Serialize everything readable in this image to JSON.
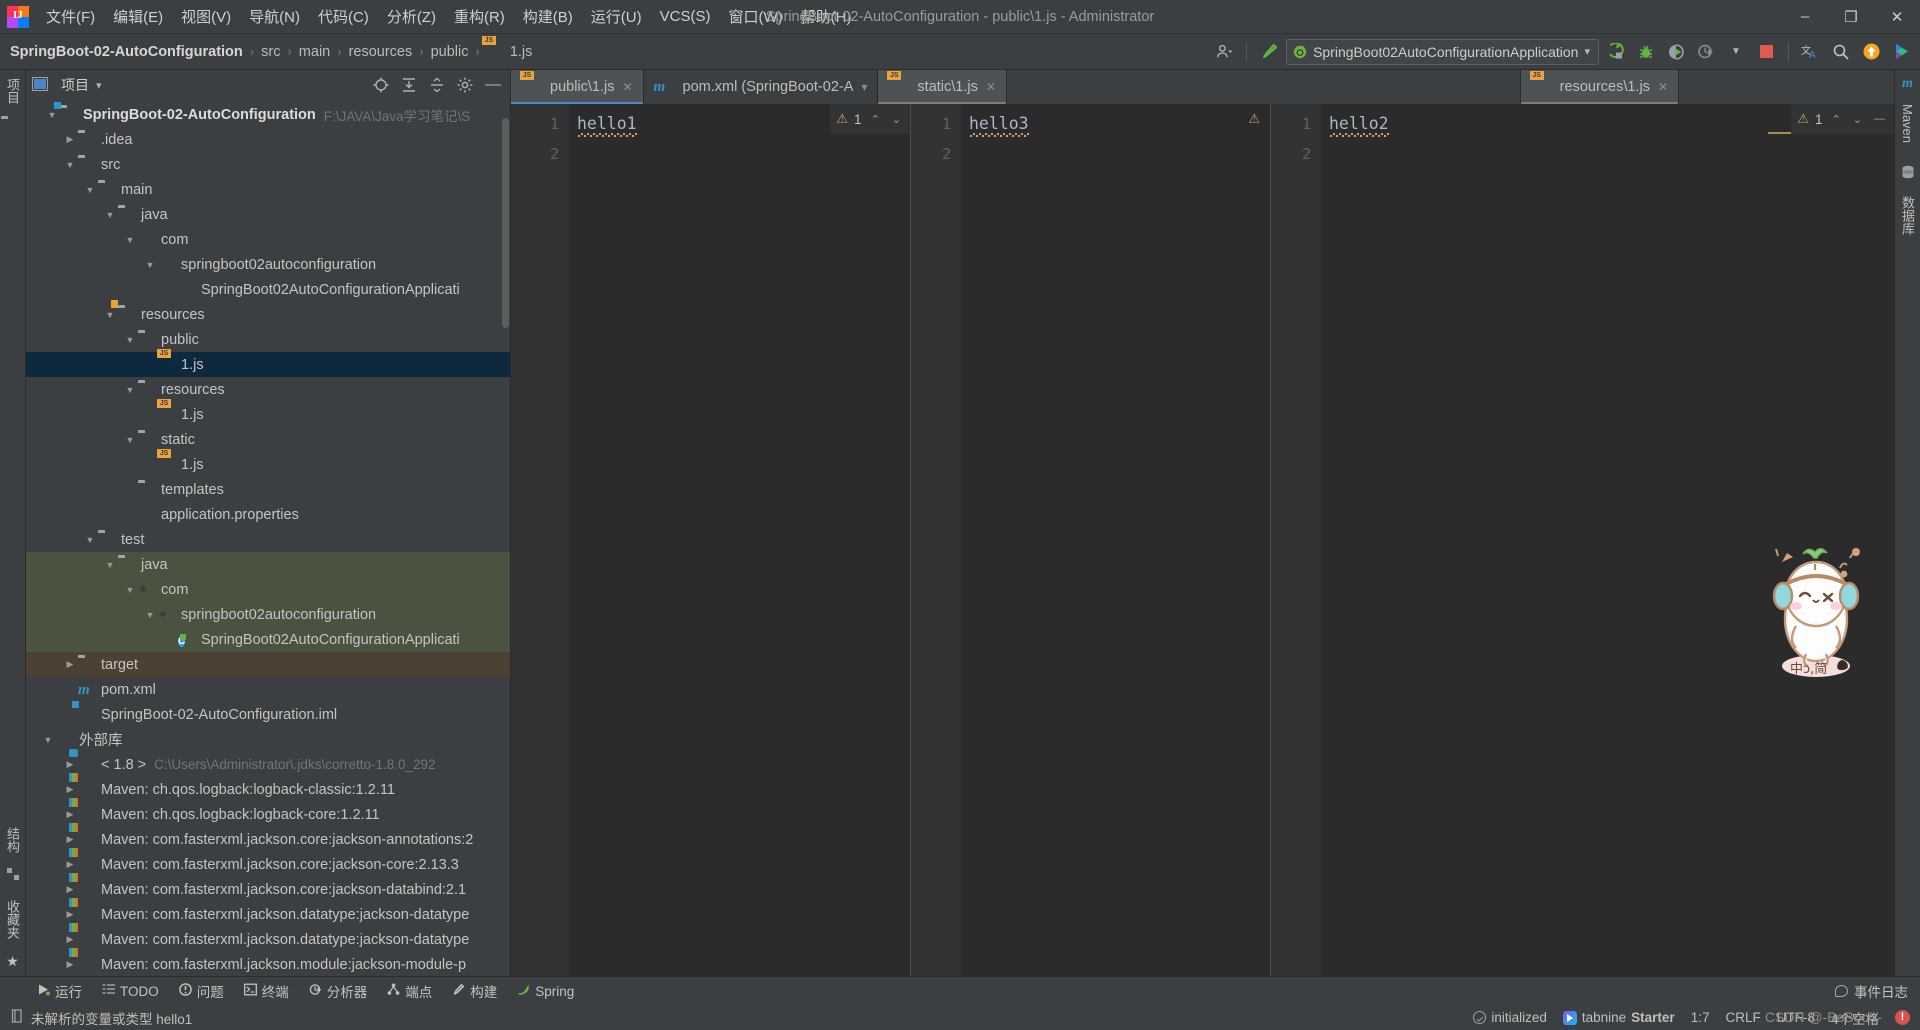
{
  "window": {
    "title": "SpringBoot-02-AutoConfiguration - public\\1.js - Administrator",
    "minimize": "–",
    "maximize": "❐",
    "close": "✕"
  },
  "menubar": {
    "items": [
      {
        "label": "文件(F)"
      },
      {
        "label": "编辑(E)"
      },
      {
        "label": "视图(V)"
      },
      {
        "label": "导航(N)"
      },
      {
        "label": "代码(C)"
      },
      {
        "label": "分析(Z)"
      },
      {
        "label": "重构(R)"
      },
      {
        "label": "构建(B)"
      },
      {
        "label": "运行(U)"
      },
      {
        "label": "VCS(S)"
      },
      {
        "label": "窗口(W)"
      },
      {
        "label": "帮助(H)"
      }
    ]
  },
  "navbar": {
    "breadcrumbs": [
      "SpringBoot-02-AutoConfiguration",
      "src",
      "main",
      "resources",
      "public",
      "1.js"
    ],
    "separator": "›",
    "run_configuration": "SpringBoot02AutoConfigurationApplication",
    "dropdown_caret": "▾",
    "icons": [
      {
        "name": "user-settings-icon",
        "glyph": "👤"
      },
      {
        "name": "build-hammer-icon",
        "glyph": "🔨"
      },
      {
        "name": "run-icon",
        "glyph": "▶"
      },
      {
        "name": "debug-icon",
        "glyph": "🐞"
      },
      {
        "name": "run-with-coverage-icon",
        "glyph": "▶"
      },
      {
        "name": "profiler-icon",
        "glyph": "◷"
      },
      {
        "name": "stop-icon",
        "glyph": "■"
      },
      {
        "name": "translate-icon",
        "glyph": "文A"
      },
      {
        "name": "search-everywhere-icon",
        "glyph": "🔍"
      },
      {
        "name": "update-icon",
        "glyph": "↑"
      },
      {
        "name": "ide-helper-icon",
        "glyph": "▶"
      }
    ]
  },
  "project_panel": {
    "title": "项目",
    "dropdown_caret": "▾",
    "header_icons": [
      "locate-icon",
      "expand-all-icon",
      "collapse-all-icon",
      "settings-gear-icon",
      "hide-icon"
    ],
    "tree": [
      {
        "label": "SpringBoot-02-AutoConfiguration",
        "secondary": "F:\\JAVA\\Java学习笔记\\S",
        "depth": 0,
        "arrow": "v",
        "icon": "folder-module",
        "bold": true,
        "state": "normal"
      },
      {
        "label": ".idea",
        "depth": 1,
        "arrow": ">",
        "icon": "folder",
        "state": "normal"
      },
      {
        "label": "src",
        "depth": 1,
        "arrow": "v",
        "icon": "folder",
        "state": "normal"
      },
      {
        "label": "main",
        "depth": 2,
        "arrow": "v",
        "icon": "folder",
        "state": "normal"
      },
      {
        "label": "java",
        "depth": 3,
        "arrow": "v",
        "icon": "folder-source",
        "state": "normal"
      },
      {
        "label": "com",
        "depth": 4,
        "arrow": "v",
        "icon": "package",
        "state": "normal"
      },
      {
        "label": "springboot02autoconfiguration",
        "depth": 5,
        "arrow": "v",
        "icon": "package",
        "state": "normal"
      },
      {
        "label": "SpringBoot02AutoConfigurationApplicati",
        "depth": 6,
        "arrow": "",
        "icon": "spring-class",
        "state": "normal"
      },
      {
        "label": "resources",
        "depth": 3,
        "arrow": "v",
        "icon": "folder-resources",
        "state": "normal"
      },
      {
        "label": "public",
        "depth": 4,
        "arrow": "v",
        "icon": "folder",
        "state": "normal"
      },
      {
        "label": "1.js",
        "depth": 5,
        "arrow": "",
        "icon": "js-file",
        "state": "selected"
      },
      {
        "label": "resources",
        "depth": 4,
        "arrow": "v",
        "icon": "folder",
        "state": "normal"
      },
      {
        "label": "1.js",
        "depth": 5,
        "arrow": "",
        "icon": "js-file",
        "state": "normal"
      },
      {
        "label": "static",
        "depth": 4,
        "arrow": "v",
        "icon": "folder",
        "state": "normal"
      },
      {
        "label": "1.js",
        "depth": 5,
        "arrow": "",
        "icon": "js-file",
        "state": "normal"
      },
      {
        "label": "templates",
        "depth": 4,
        "arrow": "",
        "icon": "folder",
        "state": "normal"
      },
      {
        "label": "application.properties",
        "depth": 4,
        "arrow": "",
        "icon": "spring-properties",
        "state": "normal"
      },
      {
        "label": "test",
        "depth": 2,
        "arrow": "v",
        "icon": "folder",
        "state": "normal"
      },
      {
        "label": "java",
        "depth": 3,
        "arrow": "v",
        "icon": "folder-test",
        "state": "green"
      },
      {
        "label": "com",
        "depth": 4,
        "arrow": "v",
        "icon": "package",
        "state": "green"
      },
      {
        "label": "springboot02autoconfiguration",
        "depth": 5,
        "arrow": "v",
        "icon": "package",
        "state": "green"
      },
      {
        "label": "SpringBoot02AutoConfigurationApplicati",
        "depth": 6,
        "arrow": "",
        "icon": "test-class",
        "state": "green"
      },
      {
        "label": "target",
        "depth": 1,
        "arrow": ">",
        "icon": "folder-excluded",
        "state": "orange"
      },
      {
        "label": "pom.xml",
        "depth": 1,
        "arrow": "",
        "icon": "maven-m",
        "state": "normal"
      },
      {
        "label": "SpringBoot-02-AutoConfiguration.iml",
        "depth": 1,
        "arrow": "",
        "icon": "iml-file",
        "state": "normal"
      },
      {
        "label": "外部库",
        "depth": 0,
        "arrow": "v",
        "icon": "library",
        "state": "normal"
      },
      {
        "label": "< 1.8 >",
        "secondary": "C:\\Users\\Administrator\\.jdks\\corretto-1.8.0_292",
        "depth": 1,
        "arrow": ">",
        "icon": "jdk",
        "state": "normal"
      },
      {
        "label": "Maven: ch.qos.logback:logback-classic:1.2.11",
        "depth": 1,
        "arrow": ">",
        "icon": "maven-lib",
        "state": "normal"
      },
      {
        "label": "Maven: ch.qos.logback:logback-core:1.2.11",
        "depth": 1,
        "arrow": ">",
        "icon": "maven-lib",
        "state": "normal"
      },
      {
        "label": "Maven: com.fasterxml.jackson.core:jackson-annotations:2",
        "depth": 1,
        "arrow": ">",
        "icon": "maven-lib",
        "state": "normal"
      },
      {
        "label": "Maven: com.fasterxml.jackson.core:jackson-core:2.13.3",
        "depth": 1,
        "arrow": ">",
        "icon": "maven-lib",
        "state": "normal"
      },
      {
        "label": "Maven: com.fasterxml.jackson.core:jackson-databind:2.1",
        "depth": 1,
        "arrow": ">",
        "icon": "maven-lib",
        "state": "normal"
      },
      {
        "label": "Maven: com.fasterxml.jackson.datatype:jackson-datatype",
        "depth": 1,
        "arrow": ">",
        "icon": "maven-lib",
        "state": "normal"
      },
      {
        "label": "Maven: com.fasterxml.jackson.datatype:jackson-datatype",
        "depth": 1,
        "arrow": ">",
        "icon": "maven-lib",
        "state": "normal"
      },
      {
        "label": "Maven: com.fasterxml.jackson.module:jackson-module-p",
        "depth": 1,
        "arrow": ">",
        "icon": "maven-lib",
        "state": "normal"
      }
    ]
  },
  "left_strip": {
    "top_label": "项目",
    "bottom_labels": [
      "结构",
      "收藏夹"
    ]
  },
  "right_strip": {
    "labels": [
      "Maven",
      "数据库"
    ]
  },
  "editor": {
    "tabs": [
      {
        "label": "public\\1.js",
        "icon": "js-file",
        "active": true,
        "close": "✕"
      },
      {
        "label": "pom.xml (SpringBoot-02-A",
        "icon": "maven-m",
        "active": false,
        "close": "▾"
      },
      {
        "label": "static\\1.js",
        "icon": "js-file",
        "active": false,
        "close": "✕",
        "second_active": true
      },
      {
        "label": "resources\\1.js",
        "icon": "js-file",
        "active": false,
        "close": "✕",
        "second_active": true
      }
    ],
    "panes": [
      {
        "name": "public-1js-pane",
        "lines": [
          "1",
          "2"
        ],
        "code": "hello1",
        "inspection": {
          "count": "1",
          "warn_glyph": "⚠",
          "up": "⌃",
          "down": "⌄"
        }
      },
      {
        "name": "static-1js-pane",
        "lines": [
          "1",
          "2"
        ],
        "code": "hello3",
        "inspection": {
          "count": "",
          "warn_glyph": "⚠",
          "up": "",
          "down": ""
        }
      },
      {
        "name": "resources-1js-pane",
        "lines": [
          "1",
          "2"
        ],
        "code": "hello2",
        "inspection": {
          "count": "1",
          "warn_glyph": "⚠",
          "up": "⌃",
          "down": "⌄"
        }
      }
    ]
  },
  "tool_windows": {
    "items": [
      {
        "label": "运行",
        "icon": "run-icon"
      },
      {
        "label": "TODO",
        "icon": "todo-icon"
      },
      {
        "label": "问题",
        "icon": "problems-icon"
      },
      {
        "label": "终端",
        "icon": "terminal-icon"
      },
      {
        "label": "分析器",
        "icon": "profiler-icon"
      },
      {
        "label": "端点",
        "icon": "endpoints-icon"
      },
      {
        "label": "构建",
        "icon": "build-icon"
      },
      {
        "label": "Spring",
        "icon": "spring-icon"
      }
    ],
    "event_log": "事件日志"
  },
  "statusbar": {
    "message": "未解析的变量或类型 hello1",
    "message_icon": "inspection-icon",
    "items": [
      {
        "label": "initialized",
        "icon": "check-icon"
      },
      {
        "label": "tabnine",
        "bold_label": "Starter",
        "icon": "tabnine-icon"
      },
      {
        "label": "1:7"
      },
      {
        "label": "CRLF"
      },
      {
        "label": "UTF-8"
      },
      {
        "label": "4个空格"
      }
    ],
    "watermark": "CSDN @-BoBooY-",
    "notification_badge": "!"
  }
}
